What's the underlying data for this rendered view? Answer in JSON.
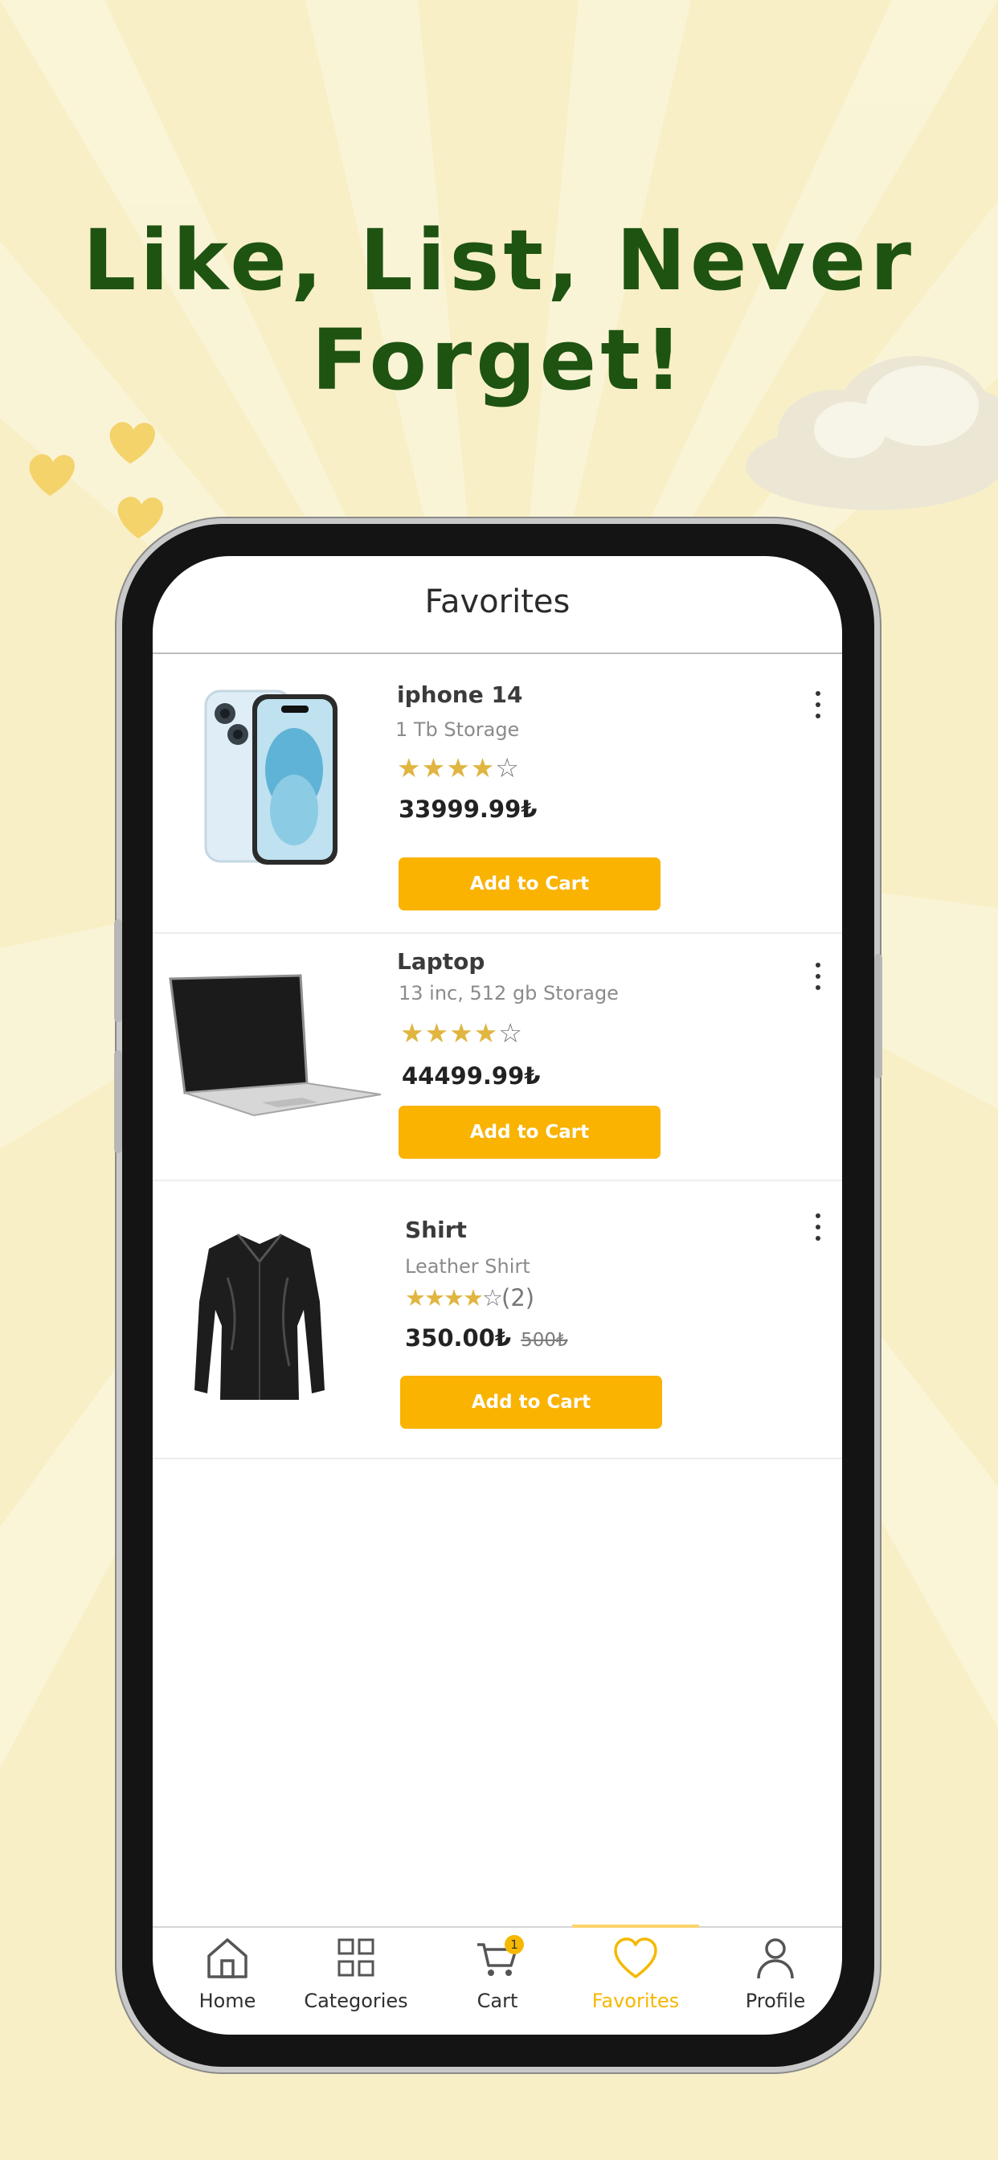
{
  "promo": {
    "headline_line1": "Like, List, Never",
    "headline_line2": "Forget!"
  },
  "screen": {
    "title": "Favorites"
  },
  "products": [
    {
      "name": "iphone 14",
      "subtitle": "1 Tb Storage",
      "rating_display": "★★★★☆",
      "price": "33999.99₺",
      "add_to_cart_label": "Add to Cart",
      "image": "iphone-image"
    },
    {
      "name": "Laptop",
      "subtitle": "13 inc, 512 gb Storage",
      "rating_display": "★★★★☆",
      "price": "44499.99₺",
      "add_to_cart_label": "Add to Cart",
      "image": "laptop-image"
    },
    {
      "name": "Shirt",
      "subtitle": "Leather Shirt",
      "rating_display": "★★★★☆",
      "rating_count": "(2)",
      "price": "350.00₺",
      "old_price": "500₺",
      "add_to_cart_label": "Add to Cart",
      "image": "shirt-image"
    }
  ],
  "bottom_nav": {
    "items": [
      {
        "label": "Home",
        "icon": "home-icon"
      },
      {
        "label": "Categories",
        "icon": "grid-icon"
      },
      {
        "label": "Cart",
        "icon": "cart-icon",
        "badge": "1"
      },
      {
        "label": "Favorites",
        "icon": "heart-icon",
        "active": true
      },
      {
        "label": "Profile",
        "icon": "user-icon"
      }
    ]
  },
  "colors": {
    "accent": "#f9b300",
    "headline": "#1e5312",
    "background": "#f8efc6",
    "star": "#e0b540"
  }
}
